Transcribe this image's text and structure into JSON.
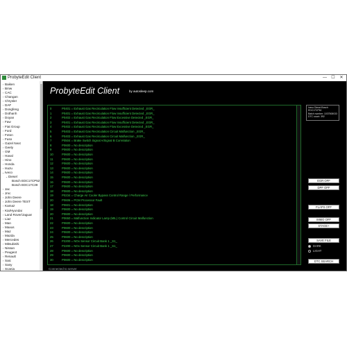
{
  "window": {
    "title": "ProbyteEdit Client",
    "minimize": "—",
    "maximize": "☐",
    "close": "✕"
  },
  "app": {
    "title": "ProbyteEdit Client",
    "byline": "by autosleep.com"
  },
  "tree": {
    "items": [
      {
        "label": "Baiken",
        "exp": "›",
        "depth": 0
      },
      {
        "label": "Bmw",
        "exp": "›",
        "depth": 0
      },
      {
        "label": "CAC",
        "exp": "›",
        "depth": 0
      },
      {
        "label": "Changan",
        "exp": "›",
        "depth": 0
      },
      {
        "label": "Chrysler",
        "exp": "›",
        "depth": 0
      },
      {
        "label": "DAF",
        "exp": "›",
        "depth": 0
      },
      {
        "label": "Dongfeng",
        "exp": "›",
        "depth": 0
      },
      {
        "label": "Dothanh",
        "exp": "›",
        "depth": 0
      },
      {
        "label": "Doyan",
        "exp": "›",
        "depth": 0
      },
      {
        "label": "Faw",
        "exp": "›",
        "depth": 0
      },
      {
        "label": "Fiat Group",
        "exp": "›",
        "depth": 0
      },
      {
        "label": "Ford",
        "exp": "›",
        "depth": 0
      },
      {
        "label": "Foton",
        "exp": "›",
        "depth": 0
      },
      {
        "label": "Fuso",
        "exp": "›",
        "depth": 0
      },
      {
        "label": "Gazel Next",
        "exp": "›",
        "depth": 0
      },
      {
        "label": "Geely",
        "exp": "›",
        "depth": 0
      },
      {
        "label": "GM",
        "exp": "›",
        "depth": 0
      },
      {
        "label": "Haval",
        "exp": "›",
        "depth": 0
      },
      {
        "label": "Hino",
        "exp": "›",
        "depth": 0
      },
      {
        "label": "Honda",
        "exp": "›",
        "depth": 0
      },
      {
        "label": "Isuzu",
        "exp": "›",
        "depth": 0
      },
      {
        "label": "Iveco",
        "exp": "⌄",
        "depth": 0
      },
      {
        "label": "Diesel",
        "exp": "⌄",
        "depth": 1
      },
      {
        "label": "Bosch EDC17CP52",
        "exp": "",
        "depth": 2
      },
      {
        "label": "Bosch EDC17C39",
        "exp": "",
        "depth": 2
      },
      {
        "label": "Jac",
        "exp": "›",
        "depth": 0
      },
      {
        "label": "Jmc",
        "exp": "›",
        "depth": 0
      },
      {
        "label": "John Deere",
        "exp": "›",
        "depth": 0
      },
      {
        "label": "John Deere TEST",
        "exp": "›",
        "depth": 0
      },
      {
        "label": "Kamaz",
        "exp": "›",
        "depth": 0
      },
      {
        "label": "Kia/Hyundai",
        "exp": "›",
        "depth": 0
      },
      {
        "label": "Land Rover/Jaguar",
        "exp": "›",
        "depth": 0
      },
      {
        "label": "Liaz",
        "exp": "›",
        "depth": 0
      },
      {
        "label": "Man",
        "exp": "›",
        "depth": 0
      },
      {
        "label": "Maxus",
        "exp": "›",
        "depth": 0
      },
      {
        "label": "Maz",
        "exp": "›",
        "depth": 0
      },
      {
        "label": "Mazda",
        "exp": "›",
        "depth": 0
      },
      {
        "label": "Mercedes",
        "exp": "›",
        "depth": 0
      },
      {
        "label": "Mitsubishi",
        "exp": "›",
        "depth": 0
      },
      {
        "label": "Nissan",
        "exp": "›",
        "depth": 0
      },
      {
        "label": "Peugeot",
        "exp": "›",
        "depth": 0
      },
      {
        "label": "Renault",
        "exp": "›",
        "depth": 0
      },
      {
        "label": "Saic",
        "exp": "›",
        "depth": 0
      },
      {
        "label": "Sany",
        "exp": "›",
        "depth": 0
      },
      {
        "label": "Scania",
        "exp": "›",
        "depth": 0
      },
      {
        "label": "Shacman",
        "exp": "›",
        "depth": 0
      }
    ]
  },
  "dtc_list": {
    "rows": [
      {
        "num": "0",
        "text": "P0401 = Exhaust Gas Recirculation Flow Insufficient Detected _EGR_"
      },
      {
        "num": "1",
        "text": "P0401 = Exhaust Gas Recirculation Flow Insufficient Detected _EGR_"
      },
      {
        "num": "2",
        "text": "P0402 = Exhaust Gas Recirculation Flow Excessive Detected _EGR_"
      },
      {
        "num": "3",
        "text": "P0401 = Exhaust Gas Recirculation Flow Insufficient Detected _EGR_"
      },
      {
        "num": "4",
        "text": "P0402 = Exhaust Gas Recirculation Flow Excessive Detected _EGR_"
      },
      {
        "num": "5",
        "text": "P0403 = Exhaust Gas Recirculation Circuit Malfunction _EGR_"
      },
      {
        "num": "6",
        "text": "P0403 = Exhaust Gas Recirculation Circuit Malfunction _EGR_"
      },
      {
        "num": "7",
        "text": "P0504 = Brake Switch Signal A/Signal B Correlation"
      },
      {
        "num": "8",
        "text": "P0600 = No description"
      },
      {
        "num": "9",
        "text": "P0600 = No description"
      },
      {
        "num": "10",
        "text": "P0600 = No description"
      },
      {
        "num": "11",
        "text": "P0600 = No description"
      },
      {
        "num": "12",
        "text": "P0600 = No description"
      },
      {
        "num": "13",
        "text": "P0600 = No description"
      },
      {
        "num": "14",
        "text": "P0600 = No description"
      },
      {
        "num": "15",
        "text": "P0600 = No description"
      },
      {
        "num": "16",
        "text": "P0600 = No description"
      },
      {
        "num": "17",
        "text": "P0600 = No description"
      },
      {
        "num": "18",
        "text": "P0600 = No description"
      },
      {
        "num": "19",
        "text": "P0234 = Charge Air Cooler Bypass Control Range / Performance"
      },
      {
        "num": "20",
        "text": "P0606 = PCM Processor Fault"
      },
      {
        "num": "18",
        "text": "P0601 = No description"
      },
      {
        "num": "19",
        "text": "P0600 = No description"
      },
      {
        "num": "20",
        "text": "P0600 = No description"
      },
      {
        "num": "21",
        "text": "P0650 = Malfunction Indicator Lamp (MIL) Control Circuit Malfunction"
      },
      {
        "num": "22",
        "text": "P0600 = No description"
      },
      {
        "num": "23",
        "text": "P0600 = No description"
      },
      {
        "num": "24",
        "text": "P0600 = No description"
      },
      {
        "num": "25",
        "text": "P0600 = No description"
      },
      {
        "num": "26",
        "text": "P2200 = NOx Sensor Circuit Bank 1 _S1_"
      },
      {
        "num": "27",
        "text": "P2200 = NOx Sensor Circuit Bank 1 _S1_"
      },
      {
        "num": "28",
        "text": "P0600 = No description"
      },
      {
        "num": "29",
        "text": "P0600 = No description"
      },
      {
        "num": "30",
        "text": "P0600 = No description"
      }
    ]
  },
  "status": "Connected to server",
  "ecu_info": {
    "lines": [
      "Iveco Diesel Bosch",
      "EDC17CP52",
      "Batch number: 1037508033",
      "DTC count: 392"
    ]
  },
  "buttons": {
    "egr_off": "EGR OFF",
    "dpf_off": "DPF OFF",
    "flaps_off": "FLAPS OFF",
    "immo_off": "IMMO OFF",
    "stage": "STAGE+",
    "save_file": "SAVE FILE",
    "dtc_search": "DTC SEARCH"
  },
  "mode_options": {
    "dark": "DARK",
    "light": "LIGHT"
  }
}
